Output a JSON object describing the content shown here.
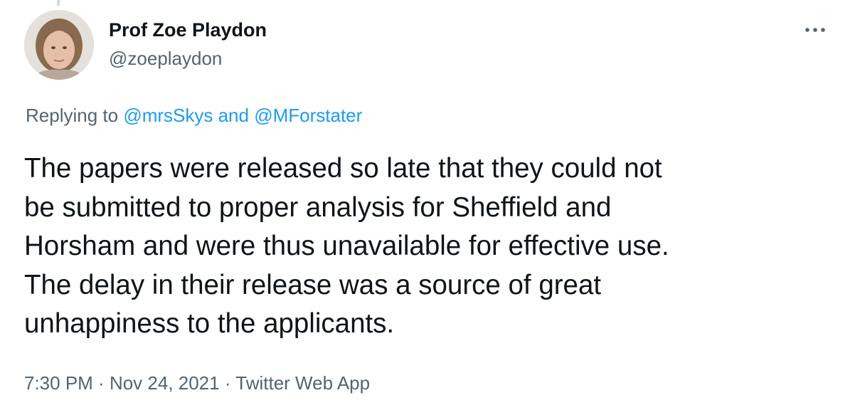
{
  "tweet": {
    "author": {
      "display_name": "Prof Zoe Playdon",
      "handle": "@zoeplaydon"
    },
    "more_icon": "more-horizontal-icon",
    "replying": {
      "prefix": "Replying to ",
      "user1": "@mrsSkys",
      "conjunction": " and ",
      "user2": "@MForstater"
    },
    "text": "The papers were released so late that they could not\nbe submitted to proper analysis for Sheffield and\nHorsham and were thus unavailable for effective use.\nThe delay in their release was a source of great\nunhappiness to the applicants.",
    "meta": {
      "time": "7:30 PM",
      "separator": " · ",
      "date": "Nov 24, 2021",
      "source": "Twitter Web App"
    }
  },
  "colors": {
    "text_primary": "#0f1419",
    "text_secondary": "#536471",
    "link": "#1d9bf0"
  }
}
